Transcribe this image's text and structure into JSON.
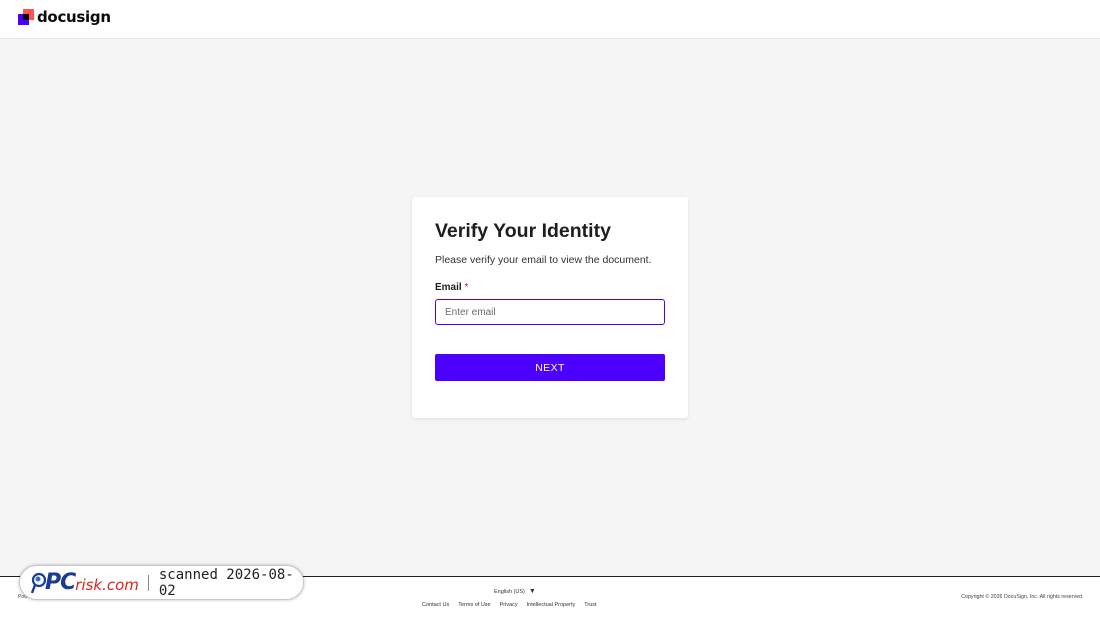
{
  "header": {
    "logo_text": "docusign",
    "logo_colors": [
      "#ff5252",
      "#4c00ff",
      "#000000"
    ]
  },
  "card": {
    "title": "Verify Your Identity",
    "subtitle": "Please verify your email to view the document.",
    "email_label": "Email",
    "required_mark": "*",
    "email_placeholder": "Enter email",
    "email_value": "",
    "next_label": "NEXT"
  },
  "footer": {
    "powered_by": "Powered by",
    "language": "English (US)",
    "language_caret": "▼",
    "links": [
      "Contact Us",
      "Terms of Use",
      "Privacy",
      "Intellectual Property",
      "Trust"
    ],
    "copyright": "Copyright © 2026 DocuSign, Inc. All rights reserved"
  },
  "watermark": {
    "brand_pc": "PC",
    "brand_risk": "risk.com",
    "scan_text": "scanned 2026-08-02"
  },
  "colors": {
    "accent": "#4c00ff",
    "required": "#c8102e",
    "background": "#f5f5f5"
  }
}
